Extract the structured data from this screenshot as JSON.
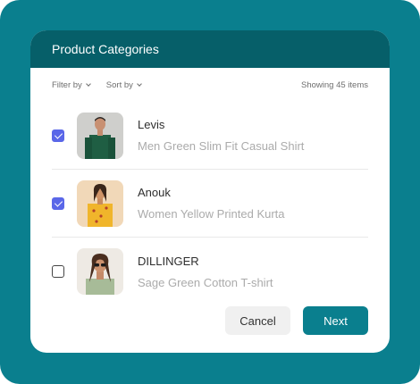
{
  "dialog": {
    "title": "Product Categories"
  },
  "toolbar": {
    "filter_label": "Filter by",
    "sort_label": "Sort by",
    "showing_text": "Showing 45 items"
  },
  "items": [
    {
      "brand": "Levis",
      "description": "Men Green Slim Fit Casual Shirt",
      "checked": true
    },
    {
      "brand": "Anouk",
      "description": "Women Yellow Printed Kurta",
      "checked": true
    },
    {
      "brand": "DILLINGER",
      "description": "Sage Green Cotton T-shirt",
      "checked": false
    }
  ],
  "actions": {
    "cancel_label": "Cancel",
    "next_label": "Next"
  },
  "colors": {
    "background": "#0a7f8e",
    "header": "#065f69",
    "checkbox_checked": "#5a67e8",
    "primary_button": "#0a7f8e"
  }
}
